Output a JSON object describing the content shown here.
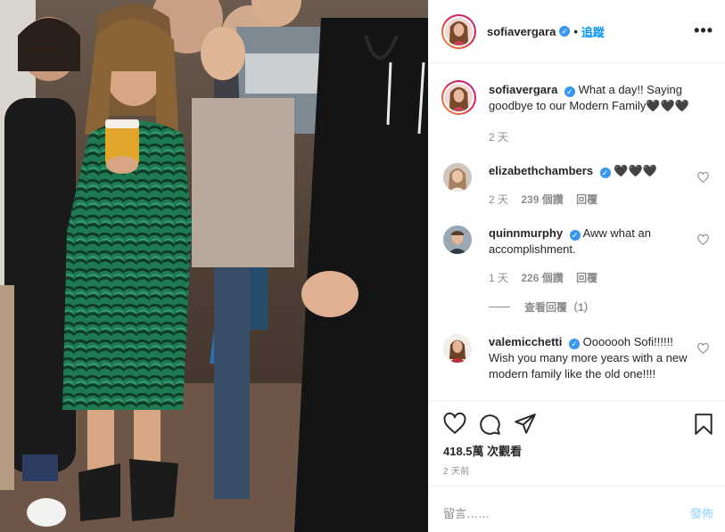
{
  "header": {
    "username": "sofiavergara",
    "verified_glyph": "✓",
    "separator": "•",
    "follow_label": "追蹤",
    "more_glyph": "•••"
  },
  "caption": {
    "username": "sofiavergara",
    "text": "What a day!! Saying goodbye to our Modern Family🖤🖤🖤",
    "age": "2 天"
  },
  "comments": [
    {
      "username": "elizabethchambers",
      "text": "🖤🖤🖤",
      "age": "2 天",
      "likes": "239 個讚",
      "reply_label": "回覆"
    },
    {
      "username": "quinnmurphy",
      "text": "Aww what an accomplishment.",
      "age": "1 天",
      "likes": "226 個讚",
      "reply_label": "回覆",
      "view_replies": "查看回覆（1）"
    },
    {
      "username": "valemicchetti",
      "text": "Ooooooh Sofi!!!!!! Wish you many more years with a new modern family like the old one!!!!"
    }
  ],
  "actions": {
    "views": "418.5萬 次觀看",
    "time": "2 天前"
  },
  "add_comment": {
    "placeholder": "留言……",
    "post_label": "發佈"
  },
  "colors": {
    "link_blue": "#0095f6",
    "verified_blue": "#3897f0",
    "muted": "#8e8e8e",
    "post_disabled": "#b2dffc"
  },
  "icons": [
    "more-icon",
    "verified-icon",
    "heart-icon",
    "comment-icon",
    "share-icon",
    "bookmark-icon"
  ]
}
